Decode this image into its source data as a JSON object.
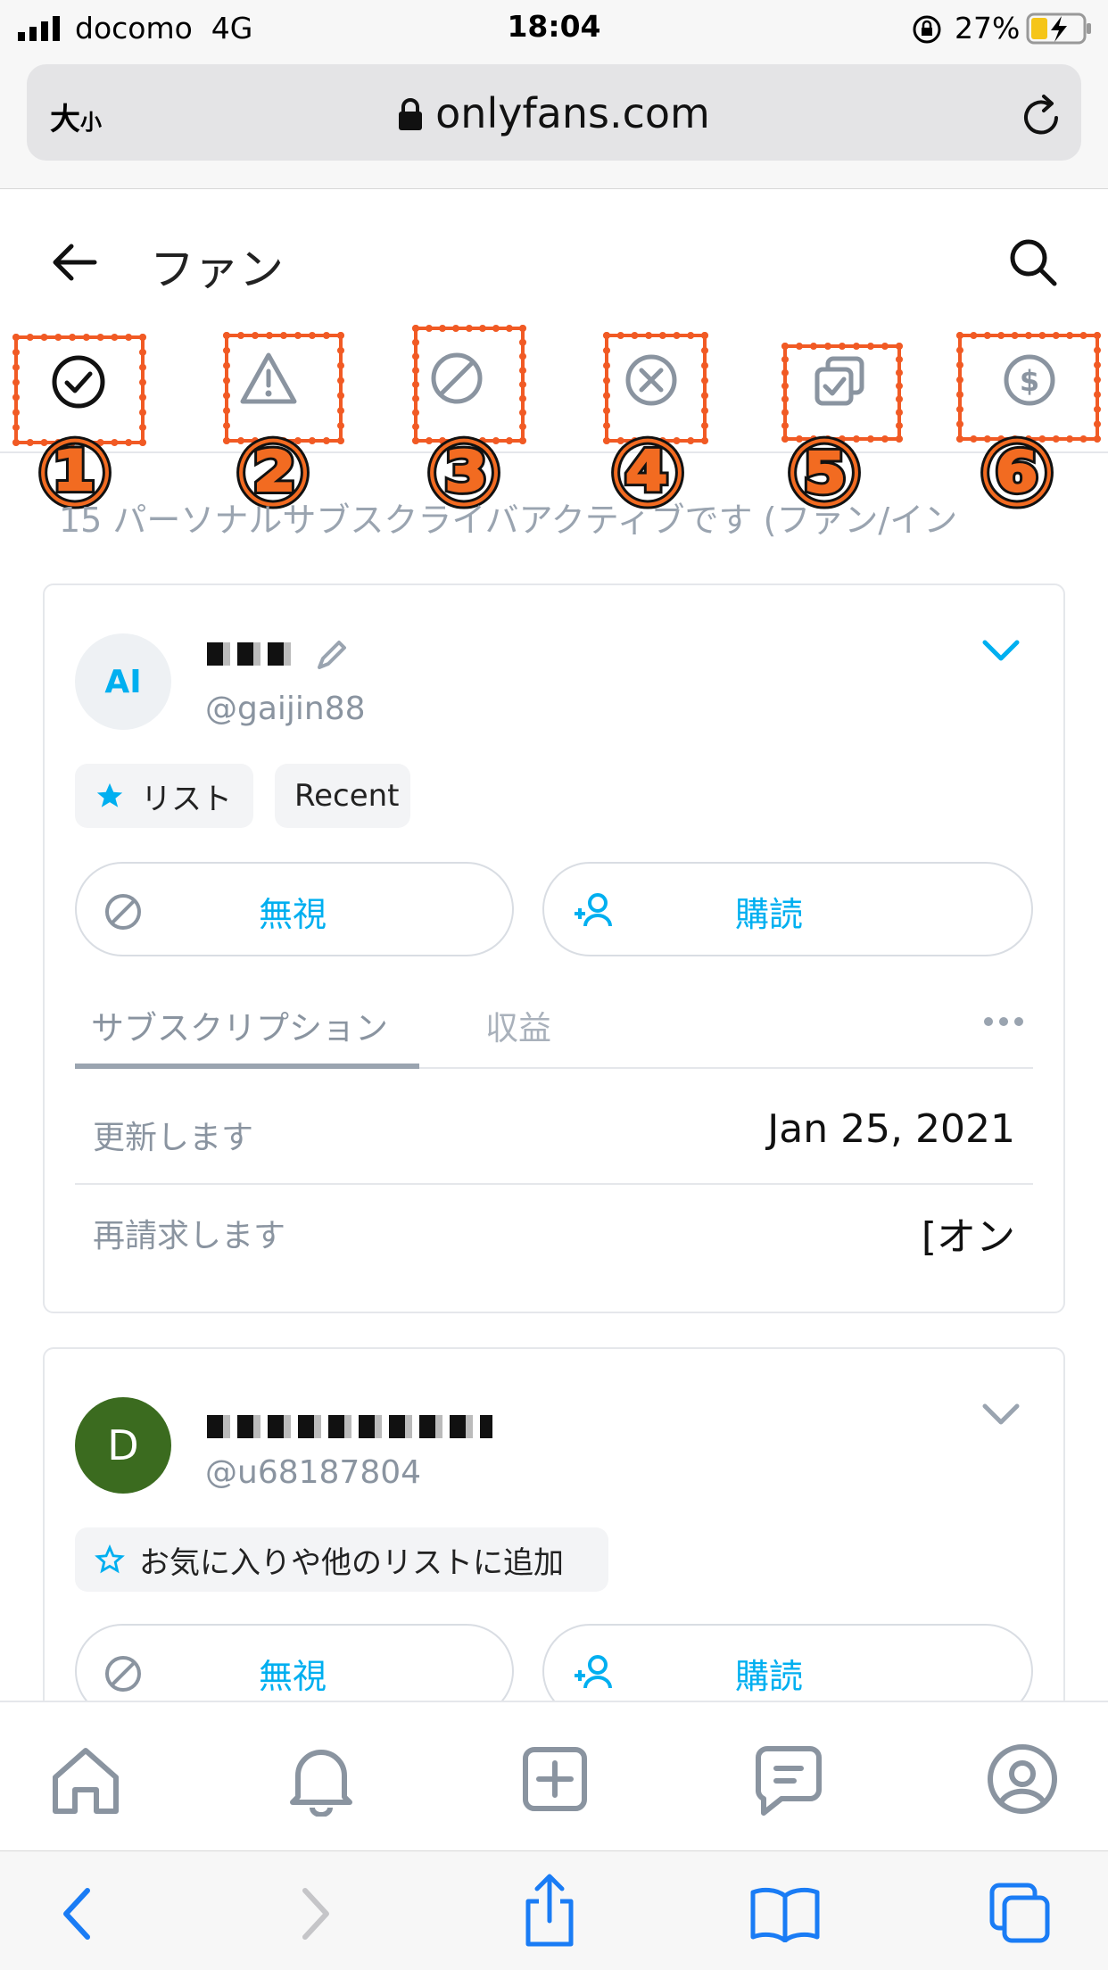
{
  "status_bar": {
    "carrier": "docomo",
    "network": "4G",
    "time": "18:04",
    "battery": "27%"
  },
  "browser": {
    "text_size_label": "大",
    "text_size_small": "小",
    "domain": "onlyfans.com"
  },
  "header": {
    "title": "ファン"
  },
  "filter_tabs": [
    {
      "icon": "check-circle-icon",
      "number": "①",
      "selected": true
    },
    {
      "icon": "warning-triangle-icon",
      "number": "②"
    },
    {
      "icon": "block-icon",
      "number": "③"
    },
    {
      "icon": "x-circle-icon",
      "number": "④"
    },
    {
      "icon": "check-squares-icon",
      "number": "⑤"
    },
    {
      "icon": "dollar-circle-icon",
      "number": "⑥"
    }
  ],
  "notice": "15 パーソナルサブスクライバアクティブです (ファン/イン",
  "fans": [
    {
      "avatar_initials": "AI",
      "handle": "@gaijin88",
      "chips": [
        {
          "label": "リスト",
          "star_filled": true
        },
        {
          "label": "Recent"
        }
      ],
      "ignore_label": "無視",
      "subscribe_label": "購読",
      "tabs": [
        "サブスクリプション",
        "収益"
      ],
      "rows": [
        {
          "label": "更新します",
          "value": "Jan 25, 2021"
        },
        {
          "label": "再請求します",
          "value": "[オン"
        }
      ]
    },
    {
      "avatar_initials": "D",
      "handle": "@u68187804",
      "chips": [
        {
          "label": "お気に入りや他のリストに追加",
          "star_filled": false
        }
      ],
      "ignore_label": "無視",
      "subscribe_label": "購読"
    }
  ],
  "colors": {
    "accent": "#00aff0",
    "highlight": "#f15a24",
    "avatar_green": "#3b6b1f",
    "muted": "#8a94a0"
  }
}
